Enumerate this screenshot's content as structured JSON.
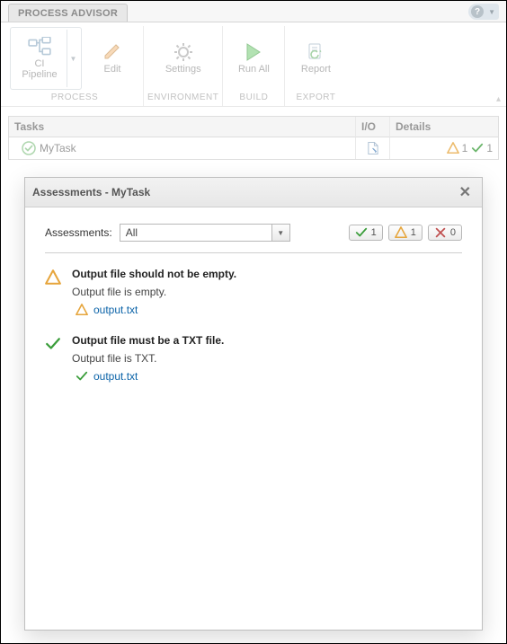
{
  "tab": {
    "title": "PROCESS ADVISOR"
  },
  "help": {
    "glyph": "?",
    "dropdown_glyph": "▼"
  },
  "toolstrip": {
    "groups": {
      "process": {
        "label": "PROCESS",
        "button": "CI\nPipeline",
        "edit": "Edit"
      },
      "environment": {
        "label": "ENVIRONMENT",
        "settings": "Settings"
      },
      "build": {
        "label": "BUILD",
        "runall": "Run All"
      },
      "export": {
        "label": "EXPORT",
        "report": "Report"
      }
    }
  },
  "tasktable": {
    "headers": {
      "tasks": "Tasks",
      "io": "I/O",
      "details": "Details"
    },
    "row": {
      "name": "MyTask",
      "details": {
        "warn": "1",
        "pass": "1"
      }
    }
  },
  "overlay": {
    "title": "Assessments - MyTask",
    "close_glyph": "✕",
    "filter": {
      "label": "Assessments:",
      "value": "All"
    },
    "chips": {
      "pass": "1",
      "warn": "1",
      "fail": "0"
    },
    "items": [
      {
        "status": "warn",
        "title": "Output file should not be empty.",
        "message": "Output file is empty.",
        "file_status": "warn",
        "file": "output.txt"
      },
      {
        "status": "pass",
        "title": "Output file must be a TXT file.",
        "message": "Output file is TXT.",
        "file_status": "pass",
        "file": "output.txt"
      }
    ]
  }
}
